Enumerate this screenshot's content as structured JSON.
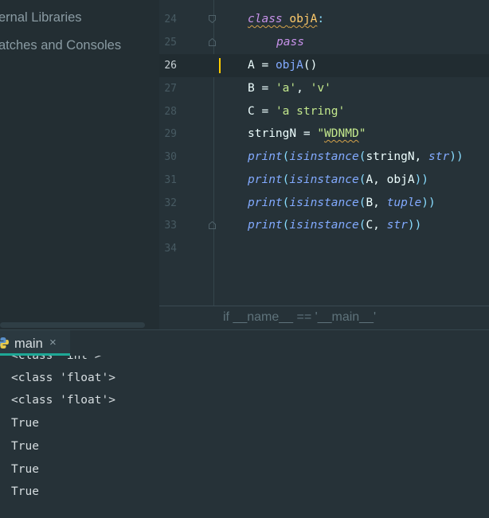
{
  "project_tree": {
    "items": [
      {
        "label": "ernal Libraries"
      },
      {
        "label": "atches and Consoles"
      }
    ]
  },
  "editor": {
    "line_numbers": [
      "24",
      "25",
      "26",
      "27",
      "28",
      "29",
      "30",
      "31",
      "32",
      "33",
      "34"
    ],
    "current_line": "26",
    "code": {
      "l24_kw": "class",
      "l24_name": "objA",
      "l24_colon": ":",
      "l25_kw": "pass",
      "l26_var": "A",
      "l26_eq": " = ",
      "l26_call": "objA",
      "l26_parens": "()",
      "l27_var": "B",
      "l27_eq": " = ",
      "l27_s1": "'a'",
      "l27_comma": ", ",
      "l27_s2": "'v'",
      "l28_var": "C",
      "l28_eq": " = ",
      "l28_str": "'a string'",
      "l29_var": "stringN",
      "l29_eq": " = ",
      "l29_q1": "\"",
      "l29_str": "WDNMD",
      "l29_q2": "\"",
      "print": "print",
      "isinstance": "isinstance",
      "open": "(",
      "close": "))",
      "comma": ", ",
      "l30_arg": "stringN",
      "l30_type": "str",
      "l31_arg": "A",
      "l31_type": "objA",
      "l32_arg": "B",
      "l32_type": "tuple",
      "l33_arg": "C",
      "l33_type": "str"
    },
    "breadcrumb": "if __name__ == '__main__'"
  },
  "run_panel": {
    "tab_label": "main",
    "close_glyph": "×",
    "console_lines": [
      "<class 'int'>",
      "<class 'float'>",
      "<class 'float'>",
      "True",
      "True",
      "True",
      "True"
    ]
  },
  "colors": {
    "background": "#263238",
    "sidebar": "#232e33",
    "keyword": "#c792ea",
    "class_name": "#ffcb6b",
    "function": "#82aaff",
    "string": "#c3e88d",
    "accent_tab": "#1ea896",
    "caret": "#ffcc00"
  }
}
